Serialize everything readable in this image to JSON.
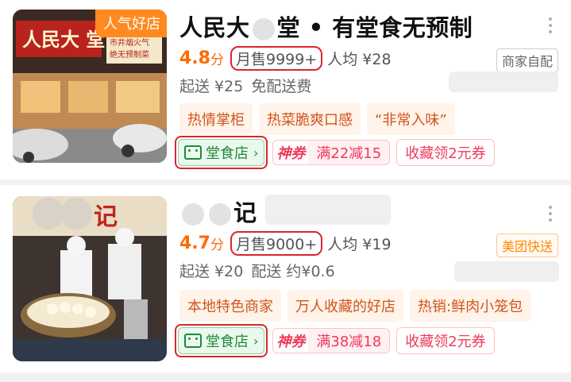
{
  "stores": [
    {
      "badge": "人气好店",
      "name_a": "人民大",
      "name_b": "堂 • 有堂食无预制",
      "score": "4.8",
      "score_unit": "分",
      "sales": "月售9999+",
      "per_capita": "人均 ¥28",
      "service_tag": "商家自配",
      "min_order": "起送 ¥25",
      "delivery_fee": "免配送费",
      "features": [
        "热情掌柜",
        "热菜脆爽口感",
        "“非常入味”"
      ],
      "dine_in": "堂食店",
      "coupon_label": "神券",
      "coupon_amount": "满22减15",
      "favorite": "收藏领2元券",
      "sign_text": "人民大 堂",
      "sign_side": "市井烟火气 绝无预制菜"
    },
    {
      "badge": "",
      "name_b": "记",
      "score": "4.7",
      "score_unit": "分",
      "sales": "月售9000+",
      "per_capita": "人均 ¥19",
      "service_tag": "美团快送",
      "min_order": "起送 ¥20",
      "delivery_fee": "配送 约¥0.6",
      "features": [
        "本地特色商家",
        "万人收藏的好店",
        "热销:鲜肉小笼包"
      ],
      "dine_in": "堂食店",
      "coupon_label": "神券",
      "coupon_amount": "满38减18",
      "favorite": "收藏领2元券",
      "sign_text": "记"
    }
  ],
  "icons": {
    "more": "more-vertical-icon",
    "dine_in": "dine-in-icon",
    "chevron": "chevron-right-icon"
  },
  "colors": {
    "accent_orange": "#ff6a00",
    "highlight_red": "#d9262c",
    "dine_green": "#1f8a3b",
    "coupon_red": "#f03a5a"
  }
}
